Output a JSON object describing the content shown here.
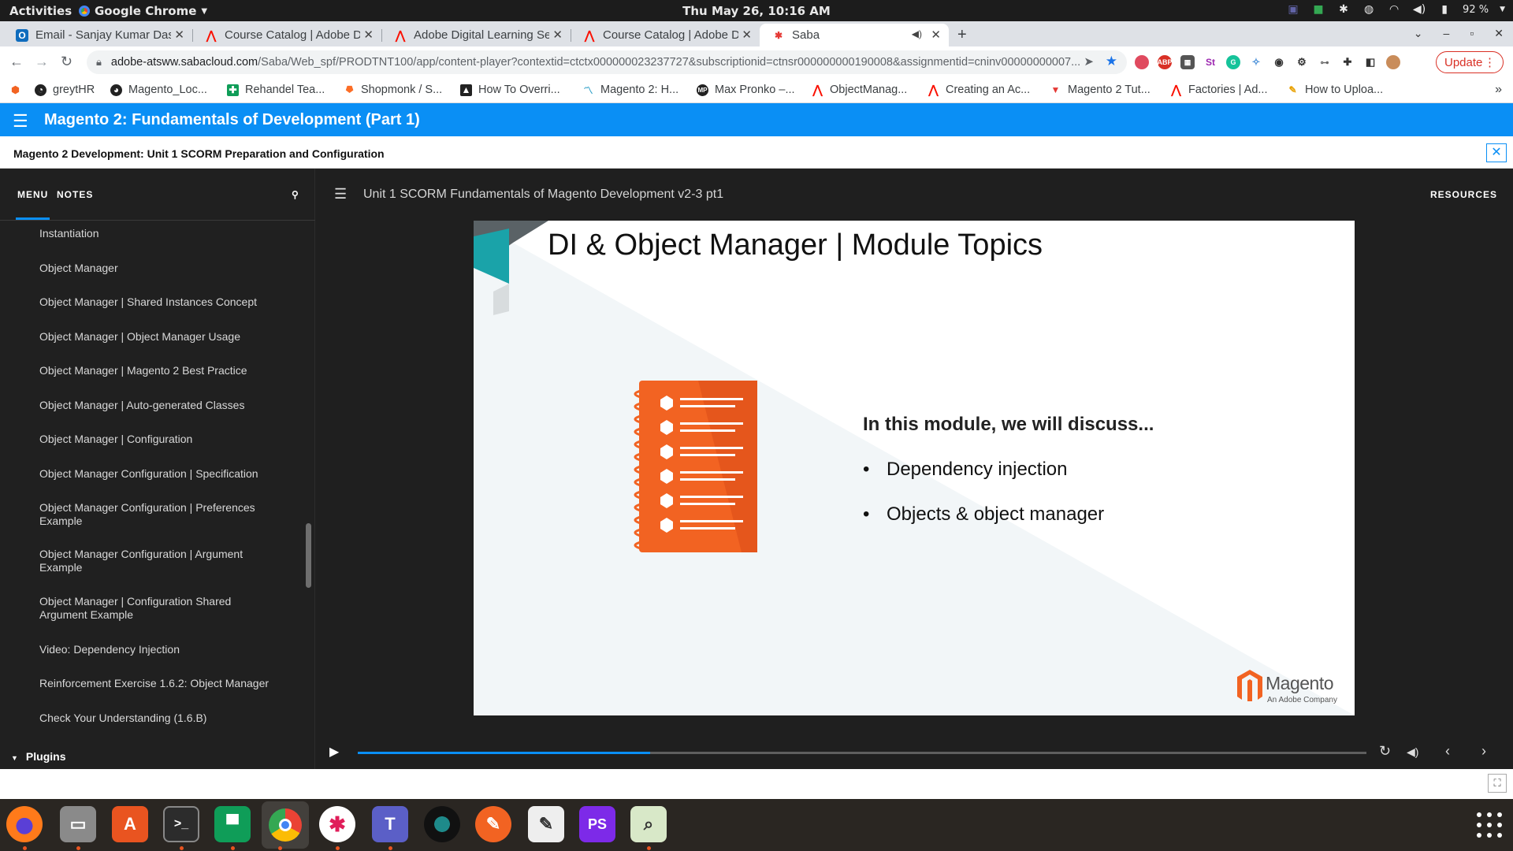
{
  "system": {
    "activities": "Activities",
    "app_name": "Google Chrome",
    "clock": "Thu May 26, 10:16 AM",
    "battery": "92 %"
  },
  "browser": {
    "tabs": [
      {
        "title": "Email - Sanjay Kumar Das",
        "icon": "outlook-icon"
      },
      {
        "title": "Course Catalog | Adobe Di",
        "icon": "adobe-icon"
      },
      {
        "title": "Adobe Digital Learning Se",
        "icon": "adobe-icon"
      },
      {
        "title": "Course Catalog | Adobe Di",
        "icon": "adobe-icon"
      },
      {
        "title": "Saba",
        "icon": "saba-icon",
        "active": true
      }
    ],
    "url_host": "adobe-atsww.sabacloud.com",
    "url_path": "/Saba/Web_spf/PRODTNT100/app/content-player?contextid=ctctx000000023237727&subscriptionid=ctnsr000000000190008&assignmentid=cninv00000000007...",
    "update_label": "Update",
    "bookmarks": [
      "greytHR",
      "Magento_Loc...",
      "Rehandel Tea...",
      "Shopmonk / S...",
      "How To Overri...",
      "Magento 2: H...",
      "Max Pronko –...",
      "ObjectManag...",
      "Creating an Ac...",
      "Magento 2 Tut...",
      "Factories | Ad...",
      "How to Uploa..."
    ]
  },
  "saba": {
    "course_title": "Magento 2: Fundamentals of Development (Part 1)",
    "unit_title": "Magento 2 Development: Unit 1 SCORM Preparation and Configuration",
    "sidebar_tab_menu": "MENU",
    "sidebar_tab_notes": "NOTES",
    "menu_items": [
      "Instantiation",
      "Object Manager",
      "Object Manager | Shared Instances Concept",
      "Object Manager | Object Manager Usage",
      "Object Manager | Magento 2 Best Practice",
      "Object Manager | Auto-generated Classes",
      "Object Manager | Configuration",
      "Object Manager Configuration | Specification",
      "Object Manager Configuration | Preferences Example",
      "Object Manager Configuration | Argument Example",
      "Object Manager | Configuration Shared Argument Example",
      "Video: Dependency Injection",
      "Reinforcement Exercise 1.6.2: Object Manager",
      "Check Your Understanding (1.6.B)"
    ],
    "section_plugins": "Plugins",
    "lesson_title": "Unit 1 SCORM Fundamentals of Magento Development v2-3 pt1",
    "resources_label": "RESOURCES",
    "playback_progress": 0.29
  },
  "slide": {
    "title": "DI & Object Manager | Module Topics",
    "intro": "In this module, we will discuss...",
    "bullets": [
      "Dependency injection",
      "Objects & object manager"
    ],
    "logo_name": "Magento",
    "logo_tagline": "An Adobe Company",
    "accent_color": "#f26322"
  },
  "dock": [
    "firefox-icon",
    "files-icon",
    "software-center-icon",
    "terminal-icon",
    "chat-icon",
    "chrome-icon",
    "slack-icon",
    "teams-icon",
    "camera-icon",
    "pen-icon",
    "text-editor-icon",
    "phpstorm-icon",
    "document-viewer-icon"
  ]
}
